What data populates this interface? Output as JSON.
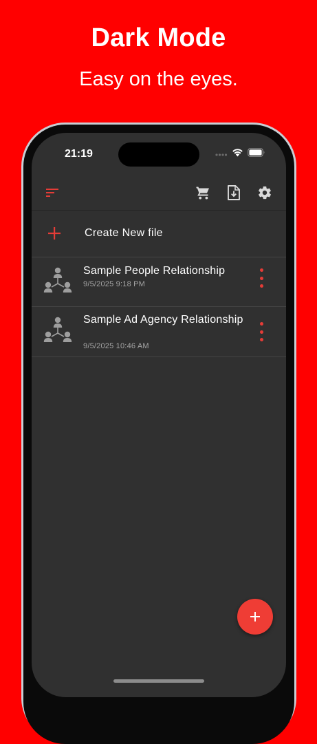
{
  "promo": {
    "title": "Dark Mode",
    "subtitle": "Easy on the eyes."
  },
  "status_bar": {
    "time": "21:19",
    "icons": [
      "cellular-signal-icon",
      "wifi-icon",
      "battery-icon"
    ]
  },
  "toolbar": {
    "left_icon": "sort-menu-icon",
    "right_icons": [
      "cart-icon",
      "import-file-icon",
      "settings-gear-icon"
    ]
  },
  "create_row": {
    "icon": "plus-icon",
    "label": "Create New file"
  },
  "files": [
    {
      "title": "Sample People Relationship",
      "date": "9/5/2025 9:18 PM",
      "icon": "relationship-graph-icon",
      "menu_icon": "more-vertical-icon"
    },
    {
      "title": "Sample Ad Agency Relationship",
      "date": "9/5/2025 10:46 AM",
      "icon": "relationship-graph-icon",
      "menu_icon": "more-vertical-icon"
    }
  ],
  "fab": {
    "icon": "plus-icon"
  },
  "colors": {
    "background": "#ff0000",
    "screen": "#303030",
    "accent": "#ef3d35",
    "text_primary": "#ffffff",
    "text_secondary": "#a5a5a5",
    "icon_gray": "#9e9e9e"
  }
}
